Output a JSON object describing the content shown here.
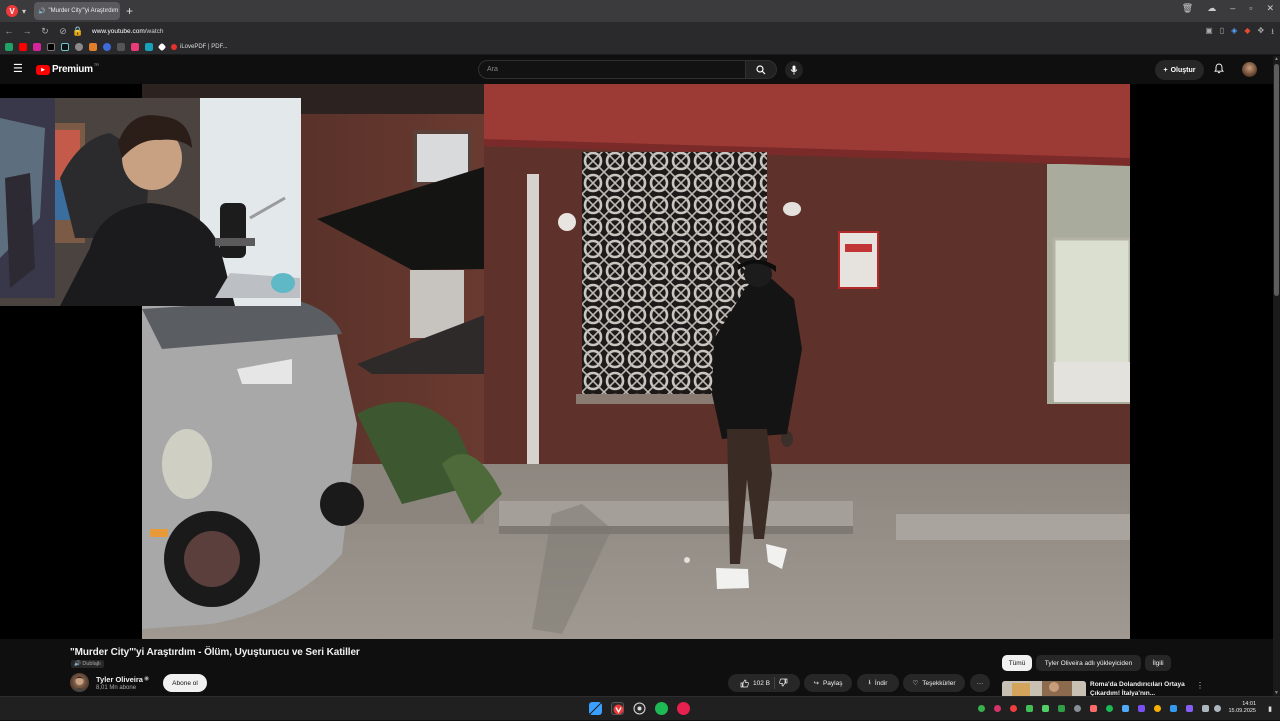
{
  "browser": {
    "tab_title": "\"Murder City\"'yi Araştırdım",
    "url_host": "www.youtube.com",
    "url_path": "/watch",
    "bookmark_label": "iLovePDF | PDF..."
  },
  "youtube": {
    "logo_text": "Premium",
    "logo_region": "TR",
    "search_placeholder": "Ara",
    "create_label": "Oluştur"
  },
  "video": {
    "title": "\"Murder City\"'yi Araştırdım - Ölüm, Uyuşturucu ve Seri Katiller",
    "dub_badge": "Dublajlı",
    "channel_name": "Tyler Oliveira",
    "subscribers": "8,01 Mn abone",
    "subscribe_label": "Abone ol",
    "likes": "102 B",
    "share_label": "Paylaş",
    "download_label": "İndir",
    "thanks_label": "Teşekkürler"
  },
  "sidebar": {
    "chips": [
      "Tümü",
      "Tyler Oliveira adlı yükleyiciden",
      "İlgili"
    ],
    "rec_title": "Roma'da Dolandırıcıları Ortaya Çıkardım! İtalya'nın..."
  },
  "taskbar": {
    "time": "14:01",
    "date": "15.09.2025"
  },
  "colors": {
    "accent_red": "#ff0000",
    "background": "#0f0f0f",
    "awning": "#9c3a36"
  }
}
